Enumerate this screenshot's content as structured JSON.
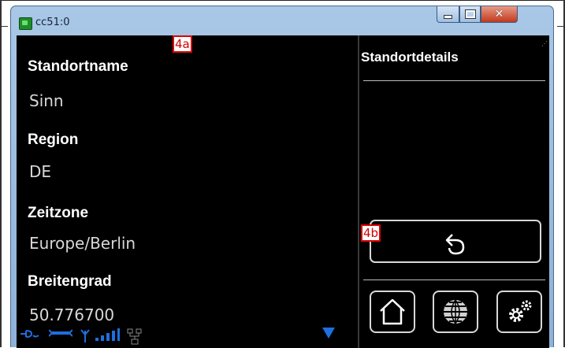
{
  "window": {
    "title": "cc51:0"
  },
  "markers": {
    "left": "4a",
    "right": "4b"
  },
  "fields": [
    {
      "label": "Standortname",
      "value": "Sinn"
    },
    {
      "label": "Region",
      "value": "DE"
    },
    {
      "label": "Zeitzone",
      "value": "Europe/Berlin"
    },
    {
      "label": "Breitengrad",
      "value": "50.776700"
    }
  ],
  "details": {
    "title": "Standortdetails"
  },
  "icons": {
    "app": "app-icon",
    "back": "back-arrow-icon",
    "home": "home-icon",
    "globe": "globe-icon",
    "settings": "gear-icon",
    "status": [
      "ethernet-icon",
      "link-icon",
      "antenna-icon",
      "signal-icon",
      "network-icon"
    ],
    "scroll": "scroll-down-icon"
  },
  "colors": {
    "accent": "#1e6fe0",
    "background": "#000000",
    "marker": "#e00000"
  }
}
